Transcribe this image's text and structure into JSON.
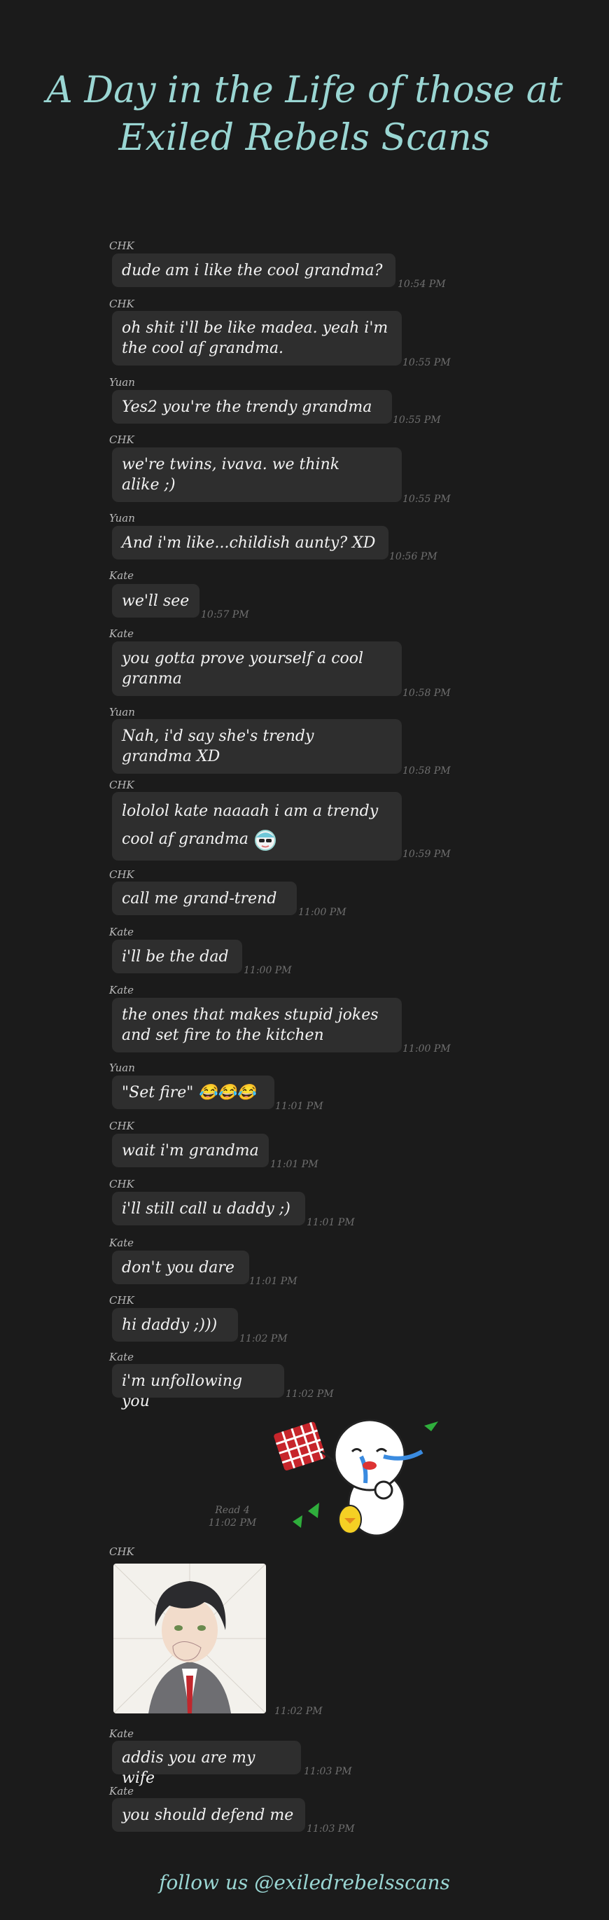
{
  "title": {
    "line1": "A Day in the Life of those at",
    "line2": "Exiled Rebels Scans"
  },
  "messages": [
    {
      "sender": "CHK",
      "text_lines": [
        "dude am i like the cool grandma?"
      ],
      "time": "10:54 PM"
    },
    {
      "sender": "CHK",
      "text_lines": [
        "oh shit i'll be like madea. yeah i'm",
        "the cool af grandma."
      ],
      "time": "10:55 PM"
    },
    {
      "sender": "Yuan",
      "text_lines": [
        "Yes2 you're the trendy grandma"
      ],
      "time": "10:55 PM"
    },
    {
      "sender": "CHK",
      "text_lines": [
        "we're twins, ivava. we think",
        "alike ;)"
      ],
      "time": "10:55 PM"
    },
    {
      "sender": "Yuan",
      "text_lines": [
        "And i'm like...childish aunty? XD"
      ],
      "time": "10:56 PM"
    },
    {
      "sender": "Kate",
      "text_lines": [
        "we'll see"
      ],
      "time": "10:57 PM"
    },
    {
      "sender": "Kate",
      "text_lines": [
        "you gotta prove yourself a cool",
        "granma"
      ],
      "time": "10:58 PM"
    },
    {
      "sender": "Yuan",
      "text_lines": [
        "Nah, i'd say she's trendy",
        "grandma XD"
      ],
      "time": "10:58 PM"
    },
    {
      "sender": "CHK",
      "text_lines": [
        "lololol kate naaaah i am a trendy",
        "cool af grandma"
      ],
      "time": "10:59 PM"
    },
    {
      "sender": "CHK",
      "text_lines": [
        "call me grand-trend"
      ],
      "time": "11:00 PM"
    },
    {
      "sender": "Kate",
      "text_lines": [
        "i'll be the dad"
      ],
      "time": "11:00 PM"
    },
    {
      "sender": "Kate",
      "text_lines": [
        "the ones that makes stupid jokes",
        "and set fire to the kitchen"
      ],
      "time": "11:00 PM"
    },
    {
      "sender": "Yuan",
      "text_lines": [
        "\"Set fire\" 😂😂😂"
      ],
      "time": "11:01 PM"
    },
    {
      "sender": "CHK",
      "text_lines": [
        "wait i'm grandma"
      ],
      "time": "11:01 PM"
    },
    {
      "sender": "CHK",
      "text_lines": [
        "i'll still call u daddy ;)"
      ],
      "time": "11:01 PM"
    },
    {
      "sender": "Kate",
      "text_lines": [
        "don't you dare"
      ],
      "time": "11:01 PM"
    },
    {
      "sender": "CHK",
      "text_lines": [
        "hi daddy ;)))"
      ],
      "time": "11:02 PM"
    },
    {
      "sender": "Kate",
      "text_lines": [
        "i'm unfollowing you"
      ],
      "time": "11:02 PM"
    }
  ],
  "sticker_message": {
    "read_label": "Read 4",
    "time": "11:02 PM"
  },
  "image_message": {
    "sender": "CHK",
    "time": "11:02 PM"
  },
  "later_messages": [
    {
      "sender": "Kate",
      "text_lines": [
        "addis you are my wife"
      ],
      "time": "11:03 PM"
    },
    {
      "sender": "Kate",
      "text_lines": [
        "you should defend me"
      ],
      "time": "11:03 PM"
    }
  ],
  "footer": "follow us @exiledrebelsscans",
  "colors": {
    "background": "#1b1b1b",
    "bubble": "#2e2e2e",
    "accent": "#9ad6d3"
  }
}
